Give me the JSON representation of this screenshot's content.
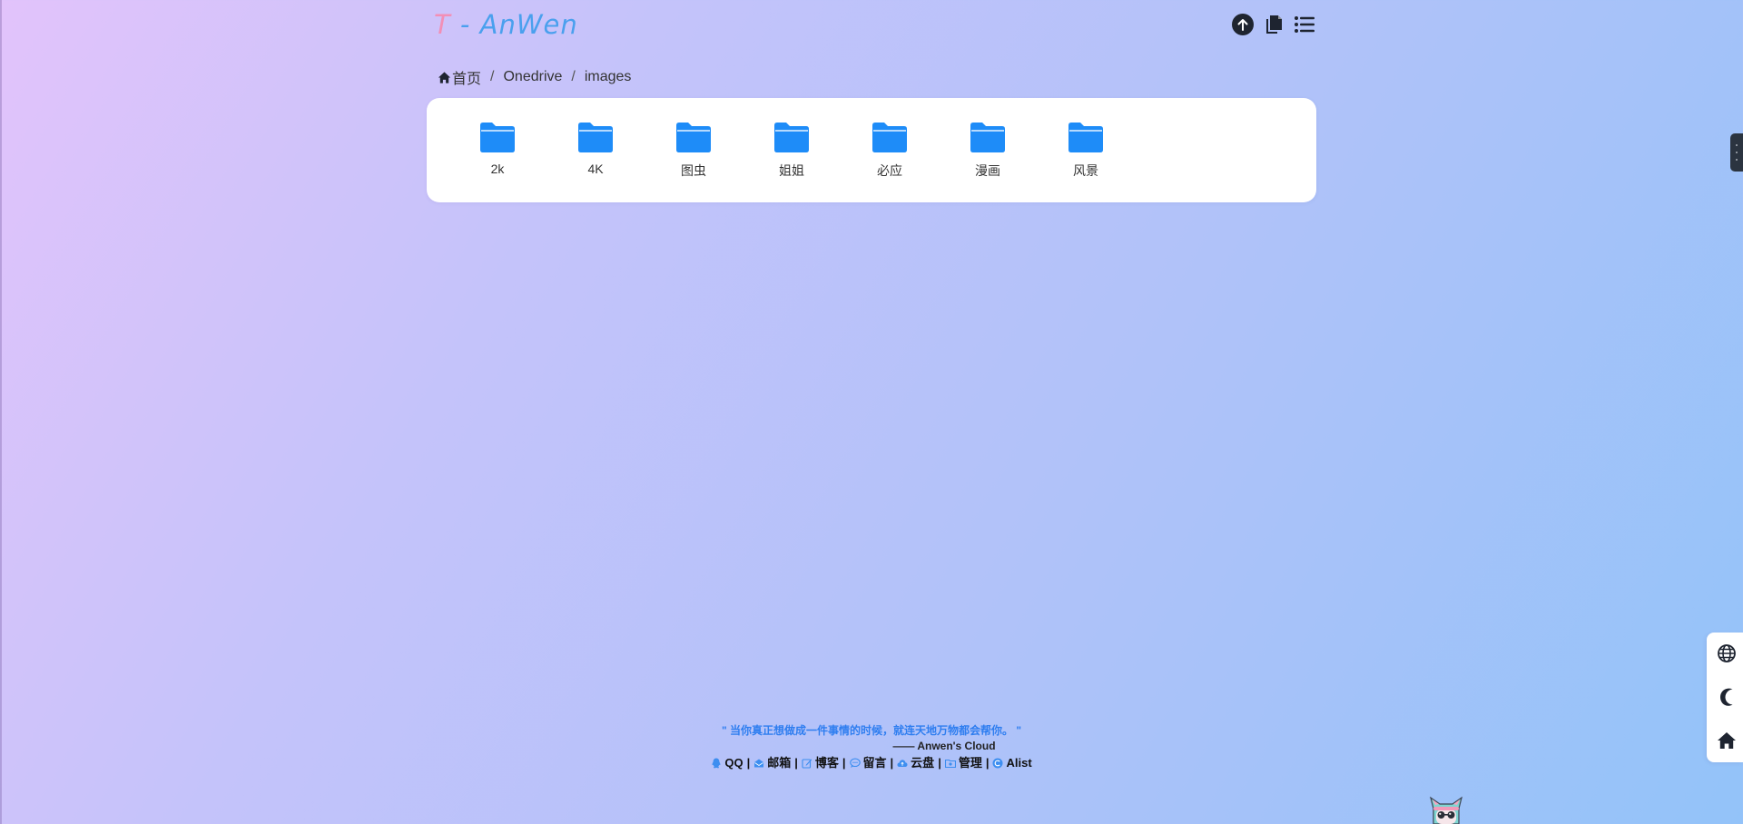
{
  "header": {
    "logo_first": "T",
    "logo_rest": " - AnWen",
    "logo_colors": {
      "first": "#f28fb6",
      "rest": "#4aa0ee"
    },
    "icons": [
      "upload-icon",
      "copy-icon",
      "list-icon"
    ]
  },
  "breadcrumb": {
    "home_label": "首页",
    "items": [
      "Onedrive",
      "images"
    ],
    "separator": "/"
  },
  "folders": [
    {
      "name": "2k"
    },
    {
      "name": "4K"
    },
    {
      "name": "图虫"
    },
    {
      "name": "姐姐"
    },
    {
      "name": "必应"
    },
    {
      "name": "漫画"
    },
    {
      "name": "风景"
    }
  ],
  "folder_color": "#1e8cf8",
  "footer": {
    "quote": "\" 当你真正想做成一件事情的时候，就连天地万物都会帮你。 \"",
    "signature": "—— Anwen's Cloud",
    "separator": "|",
    "links": [
      {
        "label": "QQ",
        "icon": "qq-icon"
      },
      {
        "label": "邮箱",
        "icon": "mail-icon"
      },
      {
        "label": "博客",
        "icon": "edit-icon"
      },
      {
        "label": "留言",
        "icon": "chat-icon"
      },
      {
        "label": "云盘",
        "icon": "cloud-icon"
      },
      {
        "label": "管理",
        "icon": "folder-icon"
      },
      {
        "label": "Alist",
        "icon": "alist-icon"
      }
    ],
    "link_icon_color": "#3d8ef0"
  },
  "side_panel": {
    "buttons": [
      "globe-icon",
      "moon-icon",
      "home-icon"
    ]
  },
  "colors": {
    "accent": "#1e8cf8",
    "quote_text": "#2f7ef0",
    "card_background": "#ffffff"
  }
}
